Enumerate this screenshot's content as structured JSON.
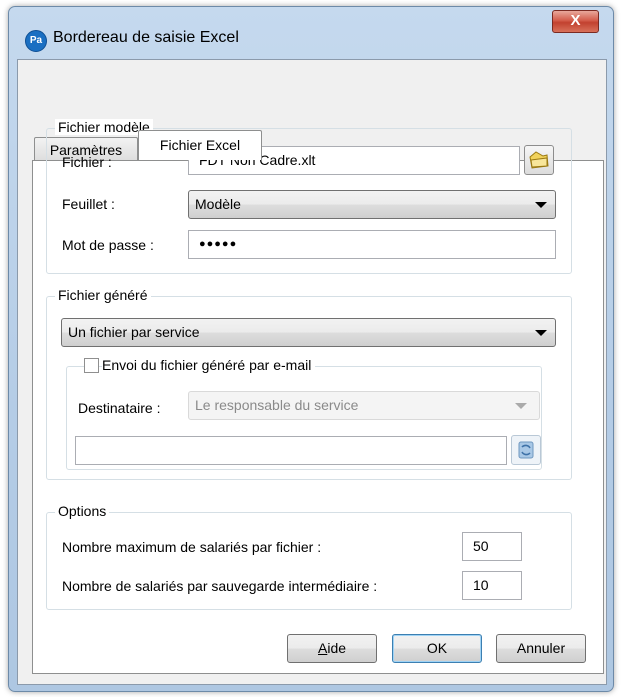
{
  "window": {
    "title": "Bordereau de saisie Excel",
    "app_icon_text": "Pa",
    "close_glyph": "X"
  },
  "tabs": [
    {
      "label": "Paramètres"
    },
    {
      "label": "Fichier Excel"
    }
  ],
  "template_group": {
    "title": "Fichier modèle",
    "file_label": "Fichier :",
    "file_value": "FDT Non Cadre.xlt",
    "sheet_label": "Feuillet :",
    "sheet_value": "Modèle",
    "password_label": "Mot de passe :",
    "password_value": "●●●●●"
  },
  "generated_group": {
    "title": "Fichier généré",
    "mode_value": "Un fichier par service",
    "email_checkbox_label": "Envoi du fichier généré par e-mail",
    "email_checked": false,
    "recipient_label": "Destinataire :",
    "recipient_value": "Le responsable du service",
    "address_value": ""
  },
  "options_group": {
    "title": "Options",
    "max_label": "Nombre maximum de salariés par fichier :",
    "max_value": "50",
    "backup_label": "Nombre de salariés par sauvegarde intermédiaire :",
    "backup_value": "10"
  },
  "buttons": {
    "help_prefix": "",
    "help_underlined": "A",
    "help_suffix": "ide",
    "ok": "OK",
    "cancel": "Annuler"
  },
  "colors": {
    "accent": "#1a6fc2",
    "close": "#c2412f",
    "panel": "#ffffff"
  }
}
